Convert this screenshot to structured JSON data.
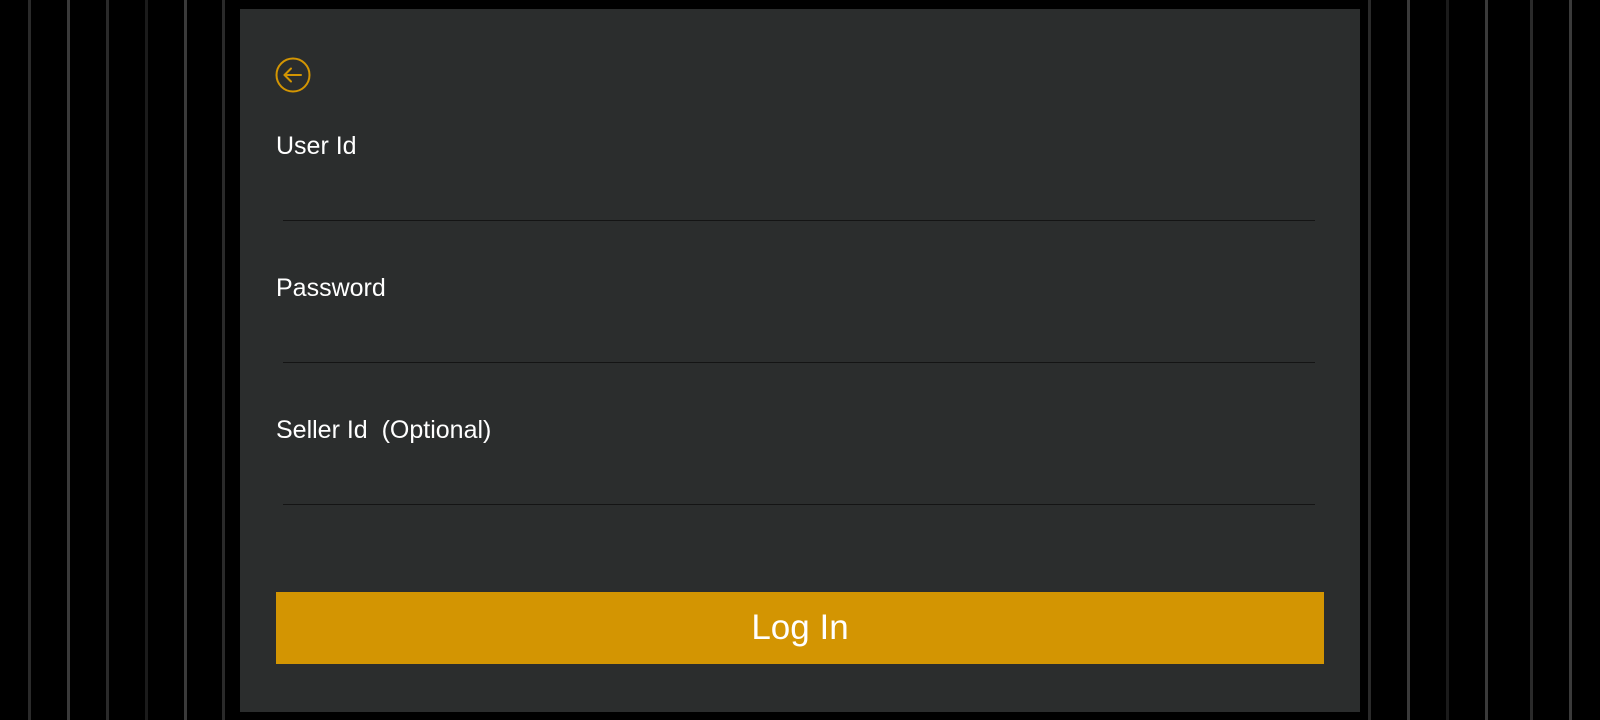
{
  "form": {
    "back_icon": "arrow-left-circle-icon",
    "user_id": {
      "label": "User Id",
      "value": "",
      "placeholder": ""
    },
    "password": {
      "label": "Password",
      "value": "",
      "placeholder": ""
    },
    "seller_id": {
      "label": "Seller Id  (Optional)",
      "value": "",
      "placeholder": ""
    },
    "login_label": "Log In"
  },
  "colors": {
    "accent": "#d39502",
    "panel": "#2b2d2d",
    "background": "#000000",
    "text": "#ffffff"
  }
}
